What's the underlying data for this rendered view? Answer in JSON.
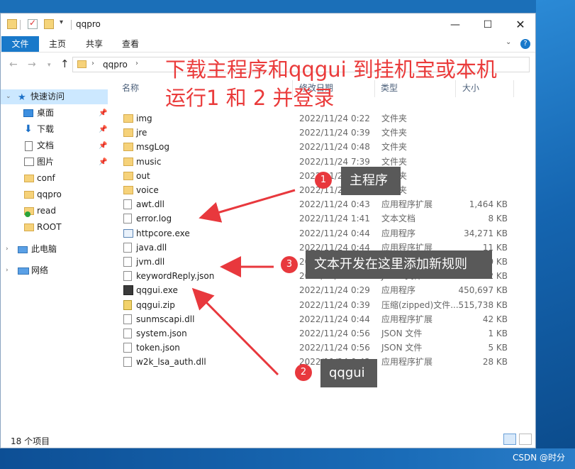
{
  "window": {
    "title": "qqpro",
    "controls": {
      "minimize": "—",
      "maximize": "☐",
      "close": "✕"
    }
  },
  "ribbon": {
    "tabs": [
      {
        "label": "文件"
      },
      {
        "label": "主页"
      },
      {
        "label": "共享"
      },
      {
        "label": "查看"
      }
    ],
    "help": "?"
  },
  "address": {
    "path": "qqpro"
  },
  "sidebar": {
    "quick_access": "快速访问",
    "items": [
      {
        "label": "桌面"
      },
      {
        "label": "下载"
      },
      {
        "label": "文档"
      },
      {
        "label": "图片"
      },
      {
        "label": "conf"
      },
      {
        "label": "qqpro"
      },
      {
        "label": "read"
      },
      {
        "label": "ROOT"
      }
    ],
    "this_pc": "此电脑",
    "network": "网络"
  },
  "columns": {
    "name": "名称",
    "date": "修改日期",
    "type": "类型",
    "size": "大小"
  },
  "files": [
    {
      "name": "img",
      "date": "2022/11/24 0:22",
      "type": "文件夹",
      "size": "",
      "kind": "folder"
    },
    {
      "name": "jre",
      "date": "2022/11/24 0:39",
      "type": "文件夹",
      "size": "",
      "kind": "folder"
    },
    {
      "name": "msgLog",
      "date": "2022/11/24 0:48",
      "type": "文件夹",
      "size": "",
      "kind": "folder"
    },
    {
      "name": "music",
      "date": "2022/11/24 7:39",
      "type": "文件夹",
      "size": "",
      "kind": "folder"
    },
    {
      "name": "out",
      "date": "2022/11/23 21:32",
      "type": "文件夹",
      "size": "",
      "kind": "folder"
    },
    {
      "name": "voice",
      "date": "2022/11/24 0:22",
      "type": "文件夹",
      "size": "",
      "kind": "folder"
    },
    {
      "name": "awt.dll",
      "date": "2022/11/24 0:43",
      "type": "应用程序扩展",
      "size": "1,464 KB",
      "kind": "file"
    },
    {
      "name": "error.log",
      "date": "2022/11/24 1:41",
      "type": "文本文档",
      "size": "8 KB",
      "kind": "file"
    },
    {
      "name": "httpcore.exe",
      "date": "2022/11/24 0:44",
      "type": "应用程序",
      "size": "34,271 KB",
      "kind": "exe"
    },
    {
      "name": "java.dll",
      "date": "2022/11/24 0:44",
      "type": "应用程序扩展",
      "size": "11 KB",
      "kind": "file"
    },
    {
      "name": "jvm.dll",
      "date": "2022/11/24 0:44",
      "type": "应用程序扩展",
      "size": "9 KB",
      "kind": "file"
    },
    {
      "name": "keywordReply.json",
      "date": "2022/11/24 0:44",
      "type": "JSON 文件",
      "size": "2 KB",
      "kind": "file"
    },
    {
      "name": "qqgui.exe",
      "date": "2022/11/24 0:29",
      "type": "应用程序",
      "size": "450,697 KB",
      "kind": "qq"
    },
    {
      "name": "qqgui.zip",
      "date": "2022/11/24 0:39",
      "type": "压缩(zipped)文件...",
      "size": "515,738 KB",
      "kind": "zip"
    },
    {
      "name": "sunmscapi.dll",
      "date": "2022/11/24 0:44",
      "type": "应用程序扩展",
      "size": "42 KB",
      "kind": "file"
    },
    {
      "name": "system.json",
      "date": "2022/11/24 0:56",
      "type": "JSON 文件",
      "size": "1 KB",
      "kind": "file"
    },
    {
      "name": "token.json",
      "date": "2022/11/24 0:56",
      "type": "JSON 文件",
      "size": "5 KB",
      "kind": "file"
    },
    {
      "name": "w2k_lsa_auth.dll",
      "date": "2022/11/24 0:43",
      "type": "应用程序扩展",
      "size": "28 KB",
      "kind": "file"
    }
  ],
  "status": {
    "count": "18 个项目"
  },
  "annotations": {
    "title": "下载主程序和qqgui 到挂机宝或本机\n运行1 和 2 并登录",
    "callout1": {
      "num": "1",
      "text": "主程序"
    },
    "callout2": {
      "num": "2",
      "text": "qqgui"
    },
    "callout3": {
      "num": "3",
      "text": "文本开发在这里添加新规则"
    },
    "color": "#ea3b3b"
  },
  "watermark": "CSDN @时分"
}
